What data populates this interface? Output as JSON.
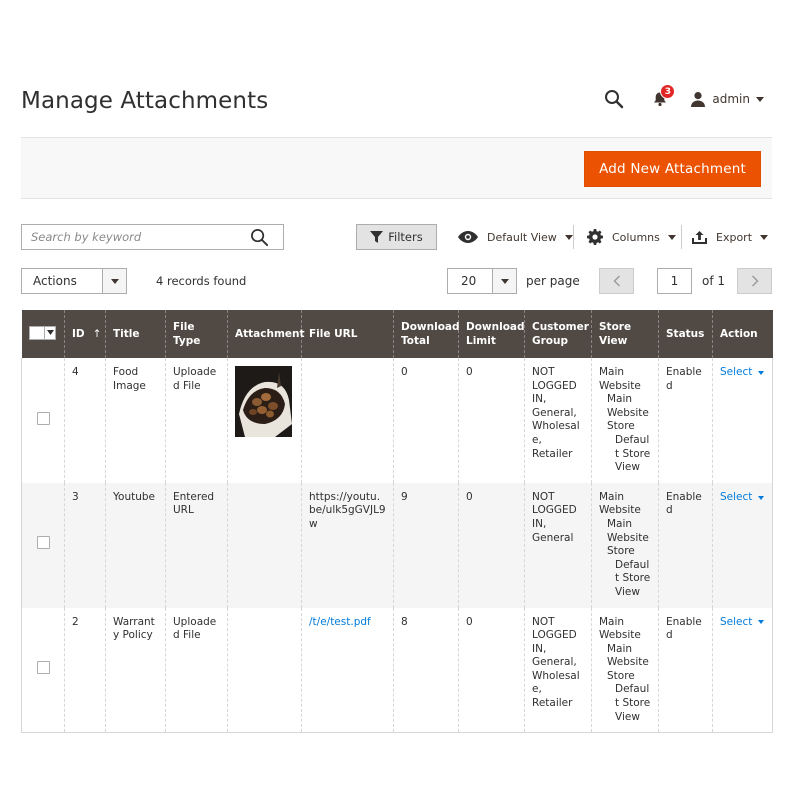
{
  "page": {
    "title": "Manage Attachments"
  },
  "header": {
    "search_icon": "search-icon",
    "notifications": {
      "icon": "bell-icon",
      "count": "3"
    },
    "user": {
      "icon": "user-icon",
      "name": "admin"
    }
  },
  "actions_bar": {
    "add_label": "Add New Attachment"
  },
  "toolbar": {
    "search_placeholder": "Search by keyword",
    "filters_label": "Filters",
    "view_label": "Default View",
    "columns_label": "Columns",
    "export_label": "Export"
  },
  "paging": {
    "actions_label": "Actions",
    "records_found": "4 records found",
    "per_page_value": "20",
    "per_page_label": "per page",
    "current_page": "1",
    "of_pages": "of 1"
  },
  "grid": {
    "columns": {
      "id": "ID",
      "id_sort": "↑",
      "title": "Title",
      "file_type": "File Type",
      "attachment": "Attachment",
      "file_url": "File URL",
      "download_total": "Download Total",
      "download_limit": "Download Limit",
      "customer_group": "Customer Group",
      "store_view": "Store View",
      "status": "Status",
      "action": "Action"
    },
    "rows": [
      {
        "id": "4",
        "title": "Food Image",
        "file_type": "Uploaded File",
        "file_url": "",
        "download_total": "0",
        "download_limit": "0",
        "customer_group": "NOT LOGGED IN, General, Wholesale, Retailer",
        "store_view": {
          "website": "Main Website",
          "store": "Main Website Store",
          "view": "Default Store View"
        },
        "status": "Enabled",
        "action": "Select"
      },
      {
        "id": "3",
        "title": "Youtube",
        "file_type": "Entered URL",
        "file_url": "https://youtu.be/ulk5gGVJL9w",
        "download_total": "9",
        "download_limit": "0",
        "customer_group": "NOT LOGGED IN, General",
        "store_view": {
          "website": "Main Website",
          "store": "Main Website Store",
          "view": "Default Store View"
        },
        "status": "Enabled",
        "action": "Select"
      },
      {
        "id": "2",
        "title": "Warranty Policy",
        "file_type": "Uploaded File",
        "file_url": "/t/e/test.pdf",
        "download_total": "8",
        "download_limit": "0",
        "customer_group": "NOT LOGGED IN, General, Wholesale, Retailer",
        "store_view": {
          "website": "Main Website",
          "store": "Main Website Store",
          "view": "Default Store View"
        },
        "status": "Enabled",
        "action": "Select"
      }
    ]
  },
  "colors": {
    "accent": "#eb5202",
    "header_bg": "#514943",
    "link": "#007bdb",
    "badge": "#e22626"
  }
}
